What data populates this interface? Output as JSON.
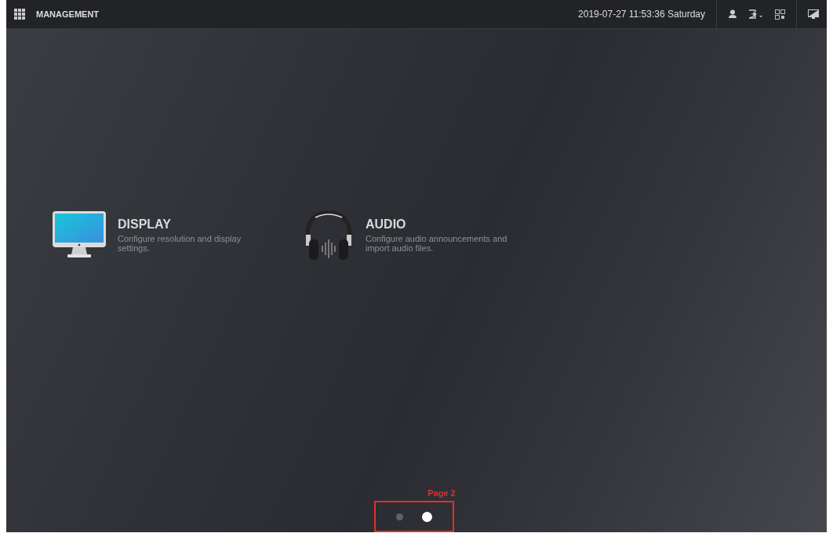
{
  "header": {
    "title": "MANAGEMENT",
    "datetime": "2019-07-27 11:53:36 Saturday"
  },
  "tiles": [
    {
      "kind": "display",
      "title": "DISPLAY",
      "description": "Configure resolution and display settings."
    },
    {
      "kind": "audio",
      "title": "AUDIO",
      "description": "Configure audio announcements and import audio files."
    }
  ],
  "pagination": [
    {
      "selected": false
    },
    {
      "selected": true
    }
  ],
  "annotation": {
    "label": "Page 2"
  }
}
